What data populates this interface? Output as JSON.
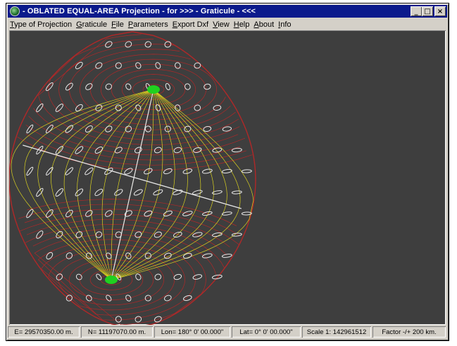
{
  "window": {
    "title": "- OBLATED EQUAL-AREA Projection - for  >>> - Graticule - <<<",
    "minimize_glyph": "_",
    "maximize_glyph": "□",
    "close_glyph": "×"
  },
  "menu": [
    {
      "accel": "T",
      "rest": "ype of Projection"
    },
    {
      "accel": "G",
      "rest": "raticule"
    },
    {
      "accel": "F",
      "rest": "ile"
    },
    {
      "accel": "P",
      "rest": "arameters"
    },
    {
      "accel": "E",
      "rest": "xport Dxf"
    },
    {
      "accel": "V",
      "rest": "iew"
    },
    {
      "accel": "H",
      "rest": "elp"
    },
    {
      "accel": "A",
      "rest": "bout"
    },
    {
      "accel": "I",
      "rest": "nfo"
    }
  ],
  "status": {
    "easting": "E= 29570350.00 m.",
    "northing": "N= 11197070.00 m.",
    "longitude": "Lon=  180° 0' 00.000\"",
    "latitude": "Lat=  0° 0' 00.000\"",
    "scale": "Scale 1: 142961512",
    "factor": "Factor -/+   200 km."
  },
  "colors": {
    "titlebar": "#0b1a8c",
    "canvas_bg": "#3e3e3e",
    "meridian": "#d8d020",
    "parallel": "#b02828",
    "indicatrix": "#e8e8e8",
    "pole": "#20d020"
  },
  "icons": {
    "app": "globe-icon",
    "minimize": "minimize-icon",
    "maximize": "maximize-icon",
    "close": "close-icon"
  }
}
